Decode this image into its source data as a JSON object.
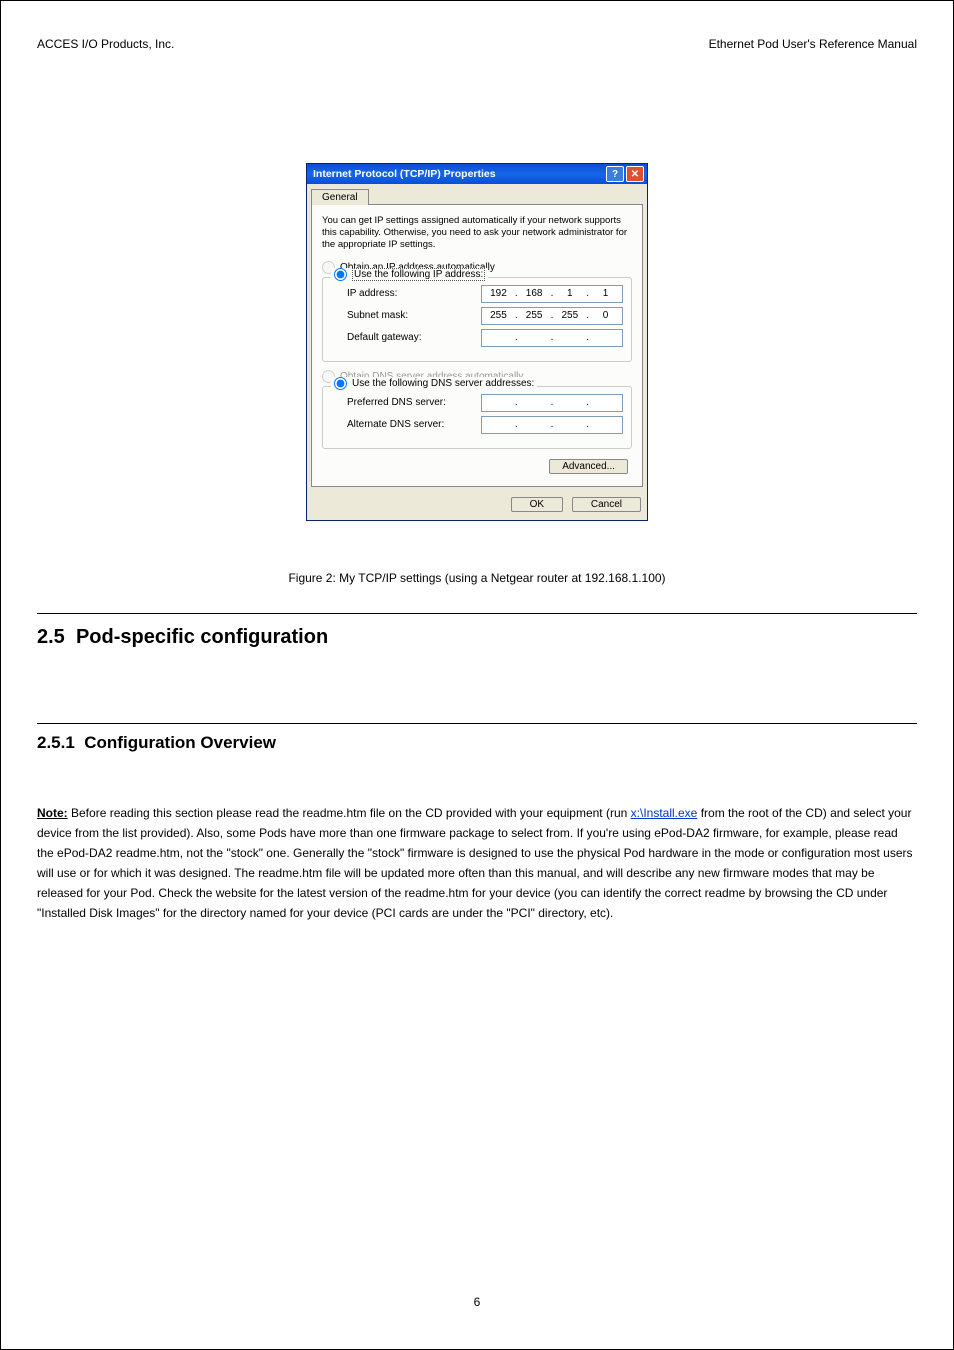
{
  "header": {
    "left": "ACCES I/O Products, Inc.",
    "right": "Ethernet Pod User's Reference Manual"
  },
  "dialog": {
    "title": "Internet Protocol (TCP/IP) Properties",
    "tab": "General",
    "description": "You can get IP settings assigned automatically if your network supports this capability. Otherwise, you need to ask your network administrator for the appropriate IP settings.",
    "radio_obtain_ip": "Obtain an IP address automatically",
    "radio_use_ip": "Use the following IP address:",
    "ip_label": "IP address:",
    "ip_value": [
      "192",
      "168",
      "1",
      "1"
    ],
    "subnet_label": "Subnet mask:",
    "subnet_value": [
      "255",
      "255",
      "255",
      "0"
    ],
    "gateway_label": "Default gateway:",
    "gateway_value": [
      "",
      "",
      "",
      ""
    ],
    "radio_obtain_dns": "Obtain DNS server address automatically",
    "radio_use_dns": "Use the following DNS server addresses:",
    "pref_dns_label": "Preferred DNS server:",
    "pref_dns_value": [
      "",
      "",
      "",
      ""
    ],
    "alt_dns_label": "Alternate DNS server:",
    "alt_dns_value": [
      "",
      "",
      "",
      ""
    ],
    "advanced": "Advanced...",
    "ok": "OK",
    "cancel": "Cancel"
  },
  "caption": "Figure 2: My TCP/IP settings (using a Netgear router at 192.168.1.100)",
  "section": {
    "number": "2.5",
    "title": "Pod-specific configuration"
  },
  "subsection": {
    "number": "2.5.1",
    "title": "Configuration Overview"
  },
  "paragraph": {
    "note": "Note:",
    "body1": " Before reading this section please read the readme.htm file on the CD provided with your equipment (run ",
    "link": "x:\\Install.exe",
    "body2": " from the root of the CD) and select your device from the list provided). Also, some Pods have more than one firmware package to select from. If you're using ePod-DA2 firmware, for example, please read the ePod-DA2 readme.htm, not the \"stock\" one. Generally the \"stock\" firmware is designed to use the physical Pod hardware in the mode or configuration most users will use or for which it was designed. The readme.htm file will be updated more often than this manual, and will describe any new firmware modes that may be released for your Pod. Check the website for the latest version of the readme.htm for your device (you can identify the correct readme by browsing the CD under \"Installed Disk Images\" for the directory named for your device (PCI cards are under the \"PCI\" directory, etc)."
  },
  "page_number": "6"
}
